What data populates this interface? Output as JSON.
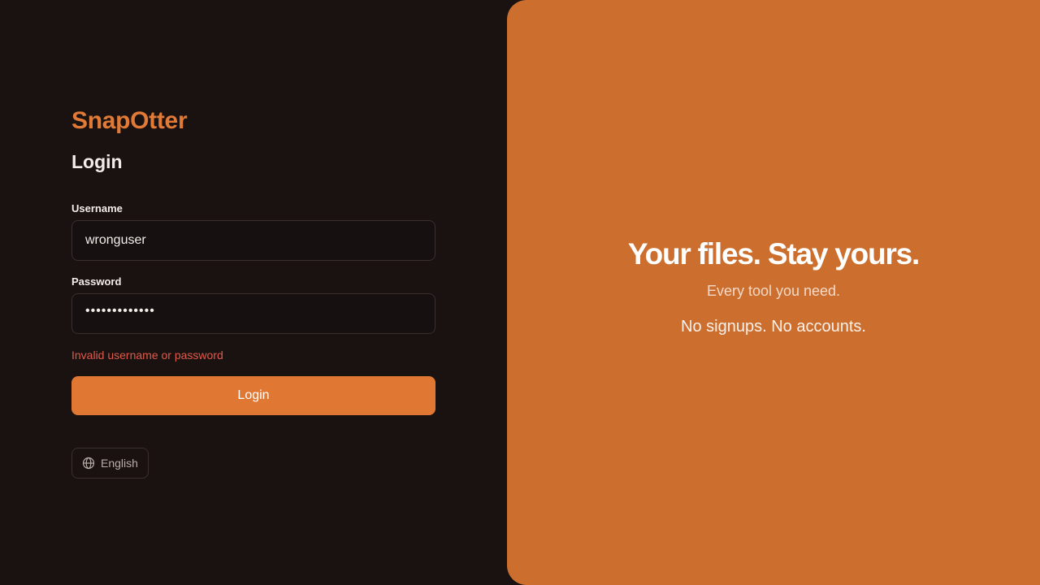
{
  "brand": {
    "name": "SnapOtter",
    "color": "#e07a36"
  },
  "login": {
    "heading": "Login",
    "username_label": "Username",
    "username_value": "wronguser",
    "password_label": "Password",
    "password_value": "•••••••••••••",
    "error": "Invalid username or password",
    "submit_label": "Login"
  },
  "language": {
    "icon": "globe-icon",
    "label": "English"
  },
  "hero": {
    "title": "Your files. Stay yours.",
    "subtitle": "Every tool you need.",
    "note": "No signups. No accounts.",
    "background": "#cb6e2e"
  },
  "colors": {
    "page_background": "#1a1211",
    "accent": "#e07834",
    "error": "#e05a4a"
  }
}
